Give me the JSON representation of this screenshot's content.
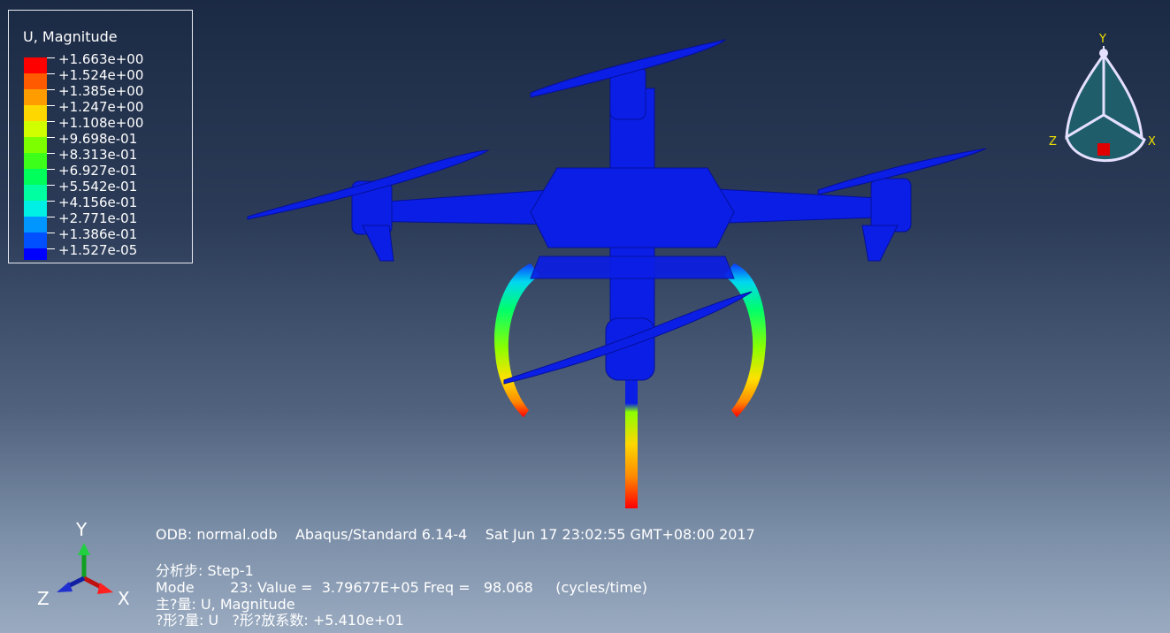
{
  "legend": {
    "title": "U, Magnitude",
    "entries": [
      {
        "label": "+1.663e+00",
        "color": "#ff0000"
      },
      {
        "label": "+1.524e+00",
        "color": "#ff5a00"
      },
      {
        "label": "+1.385e+00",
        "color": "#ff9c00"
      },
      {
        "label": "+1.247e+00",
        "color": "#ffd700"
      },
      {
        "label": "+1.108e+00",
        "color": "#d2ff00"
      },
      {
        "label": "+9.698e-01",
        "color": "#7dff00"
      },
      {
        "label": "+8.313e-01",
        "color": "#3cff1a"
      },
      {
        "label": "+6.927e-01",
        "color": "#00ff5a"
      },
      {
        "label": "+5.542e-01",
        "color": "#00ffa0"
      },
      {
        "label": "+4.156e-01",
        "color": "#00f0e6"
      },
      {
        "label": "+2.771e-01",
        "color": "#0096ff"
      },
      {
        "label": "+1.386e-01",
        "color": "#0050ff"
      },
      {
        "label": "+1.527e-05",
        "color": "#0000ff"
      }
    ]
  },
  "info": {
    "odb": "ODB: normal.odb    Abaqus/Standard 6.14-4    Sat Jun 17 23:02:55 GMT+08:00 2017",
    "step": "分析步: Step-1",
    "mode": "Mode        23: Value =  3.79677E+05 Freq =   98.068     (cycles/time)",
    "primary": "主?量: U, Magnitude",
    "deformed": "?形?量: U   ?形?放系数: +5.410e+01"
  },
  "triad": {
    "y": "Y",
    "x": "X",
    "z": "Z"
  },
  "viewcube": {
    "y": "Y",
    "x": "X",
    "z": "Z"
  },
  "colors": {
    "model": "#0a1ee6",
    "bg_top": "#1b2a44",
    "bg_bottom": "#9aabc1"
  }
}
